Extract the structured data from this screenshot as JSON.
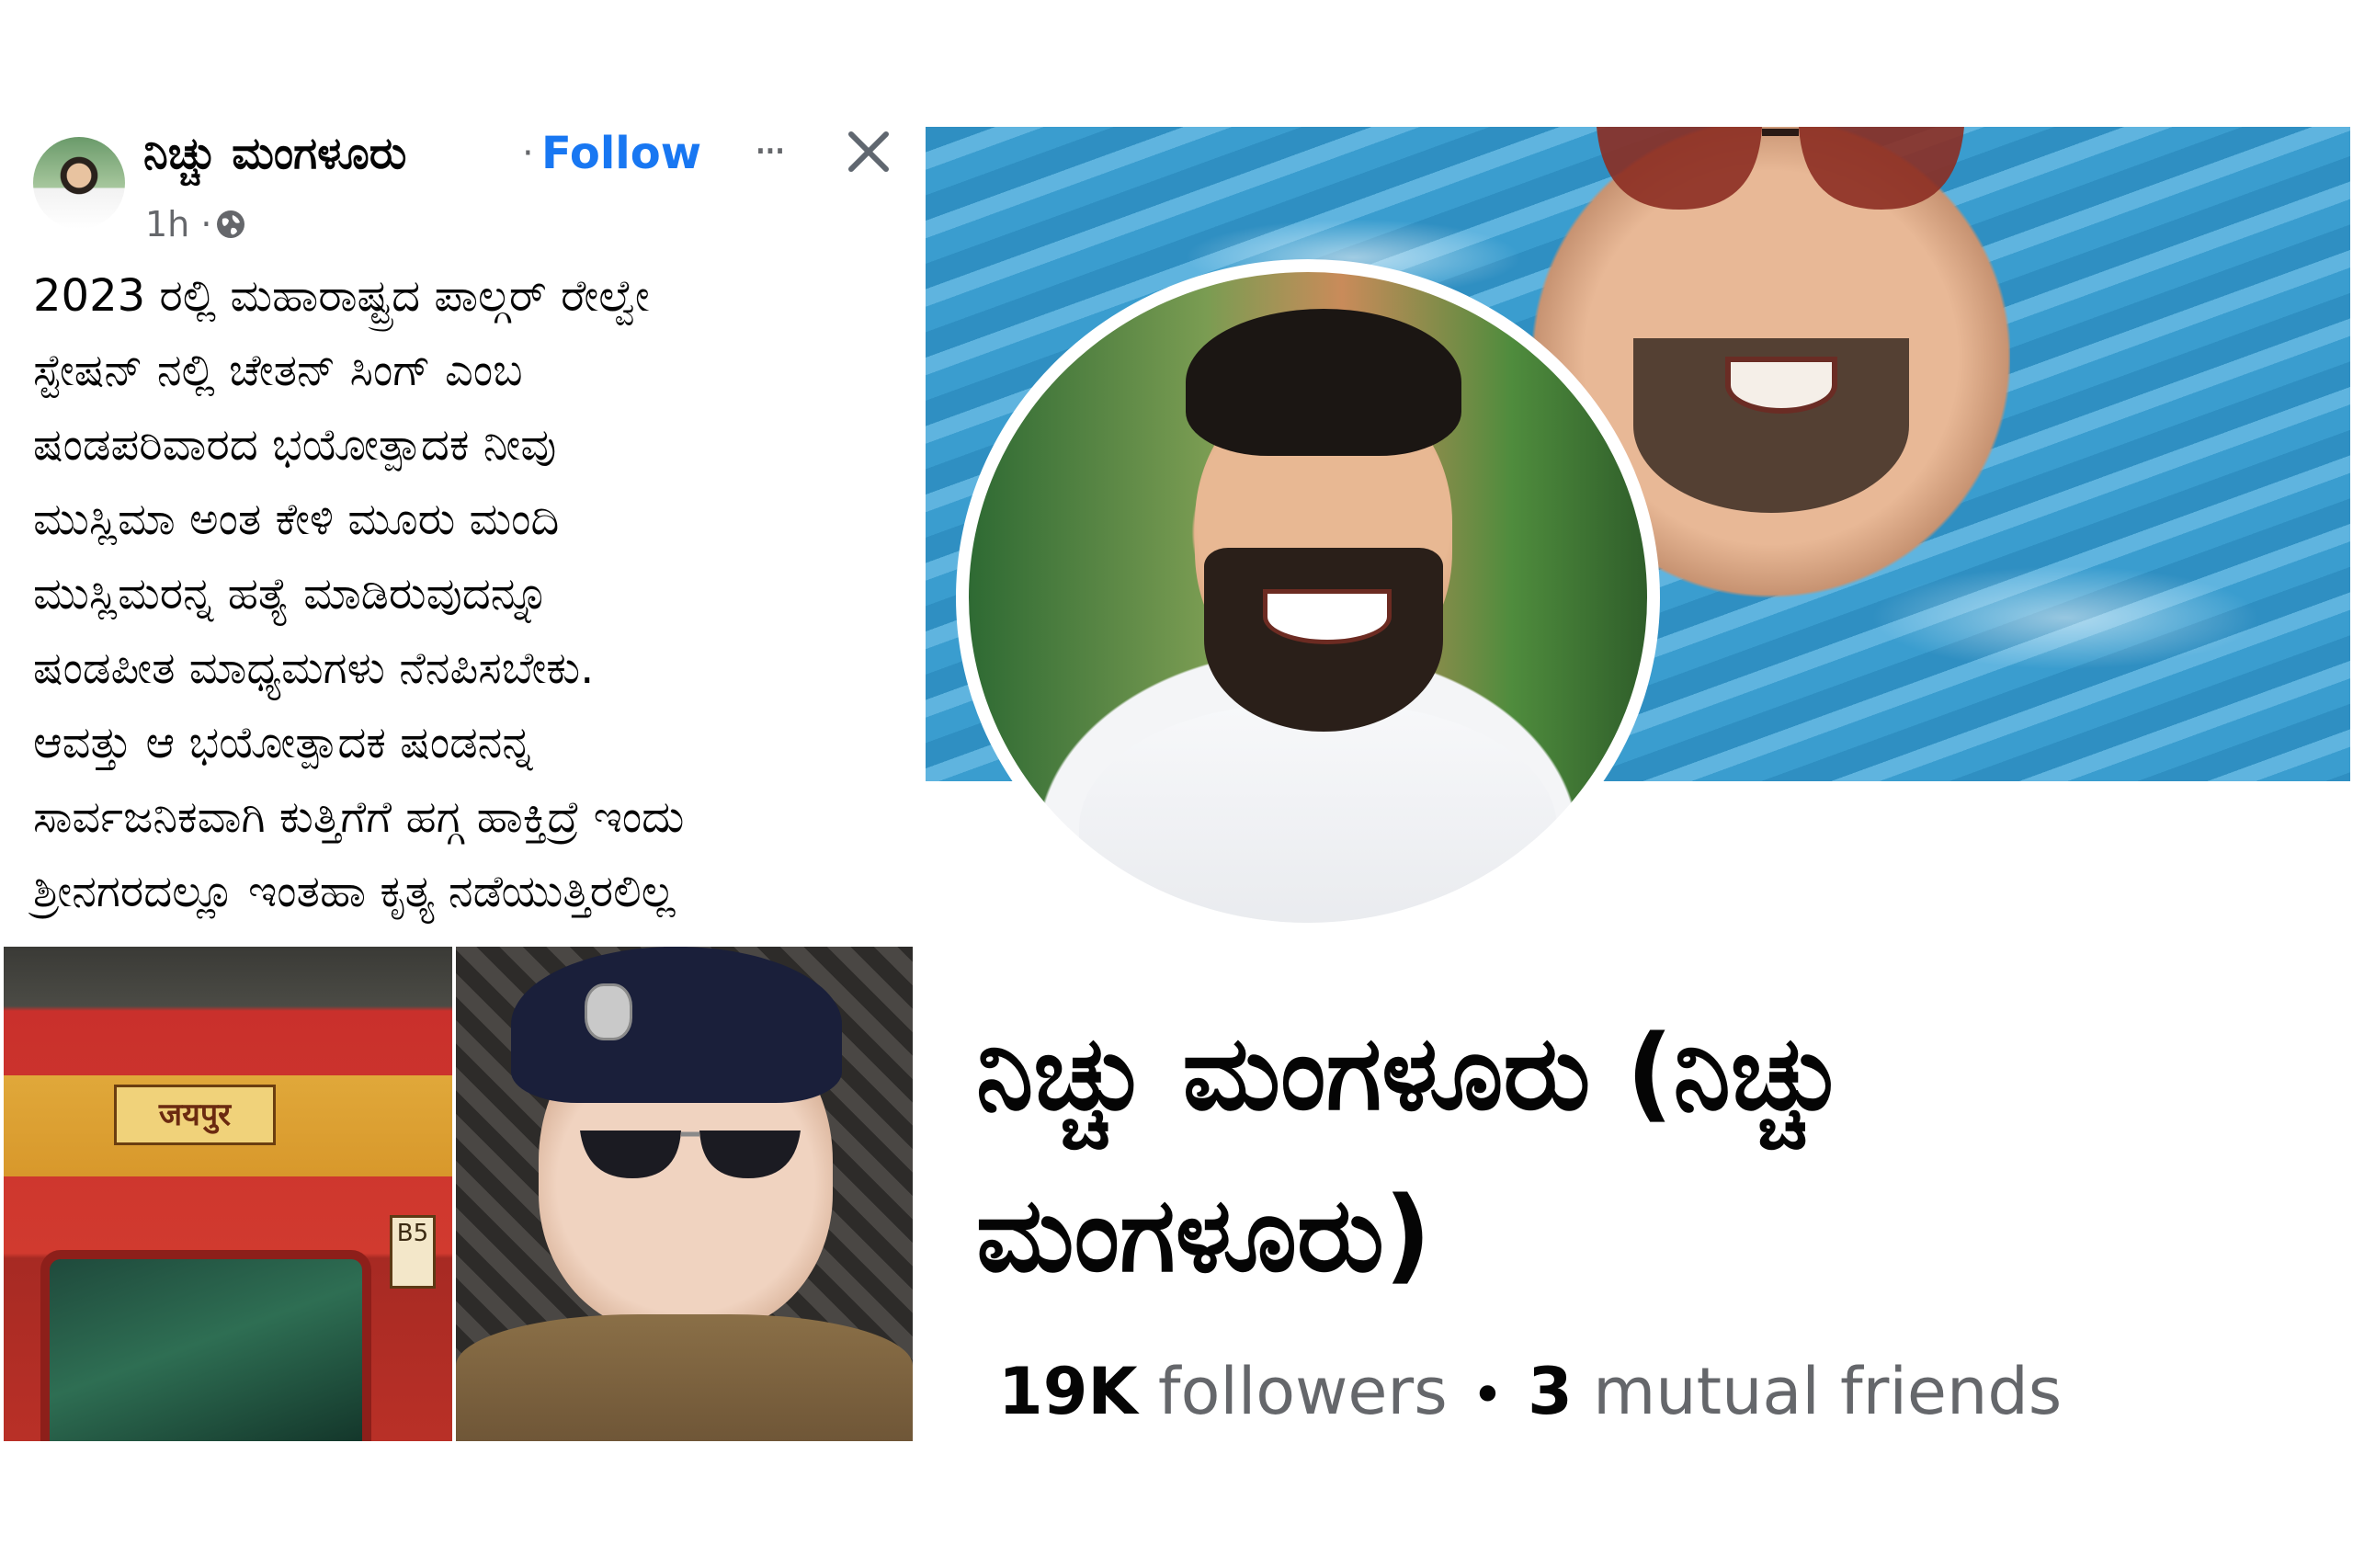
{
  "post": {
    "author": "ನಿಚ್ಚು ಮಂಗಳೂರು",
    "separator": "·",
    "follow_label": "Follow",
    "more_label": "···",
    "time": "1h ·",
    "body_lines": [
      "2023 ರಲ್ಲಿ ಮಹಾರಾಷ್ಟ್ರದ ಪಾಲ್ಗರ್ ರೇಲ್ವೇ",
      "ಸ್ಟೇಷನ್ ನಲ್ಲಿ ಚೇತನ್ ಸಿಂಗ್ ಎಂಬ",
      "ಷಂಡಪರಿವಾರದ ಭಯೋತ್ಪಾದಕ ನೀವು",
      "ಮುಸ್ಲಿಮಾ ಅಂತ ಕೇಳಿ ಮೂರು ಮಂದಿ",
      "ಮುಸ್ಲಿಮರನ್ನ ಹತ್ಯೆ ಮಾಡಿರುವುದನ್ನೂ",
      "ಷಂಡಪೀತ ಮಾಧ್ಯಮಗಳು ನೆನಪಿಸಬೇಕು.",
      "ಆವತ್ತು ಆ ಭಯೋತ್ಪಾದಕ ಷಂಡನನ್ನ",
      "ಸಾರ್ವಜನಿಕವಾಗಿ ಕುತ್ತಿಗೆಗೆ ಹಗ್ಗ ಹಾಕ್ತಿದ್ರೆ ಇಂದು",
      "ಶ್ರೀನಗರದಲ್ಲೂ ಇಂತಹಾ ಕೃತ್ಯ ನಡೆಯುತ್ತಿರಲಿಲ್ಲ"
    ],
    "photos": {
      "train_plate": "जयपुर",
      "coach_label": "B5"
    }
  },
  "profile": {
    "name_line1": "ನಿಚ್ಚು ಮಂಗಳೂರು (ನಿಚ್ಚು",
    "name_line2": "ಮಂಗಳೂರು)",
    "followers_count": "19K",
    "followers_label": "followers",
    "bullet": "•",
    "mutual_count": "3",
    "mutual_label": "mutual friends"
  },
  "colors": {
    "link": "#1877f2",
    "text": "#050505",
    "secondary": "#65676b"
  },
  "icons": [
    "avatar",
    "more-icon",
    "close-icon",
    "globe-icon"
  ]
}
